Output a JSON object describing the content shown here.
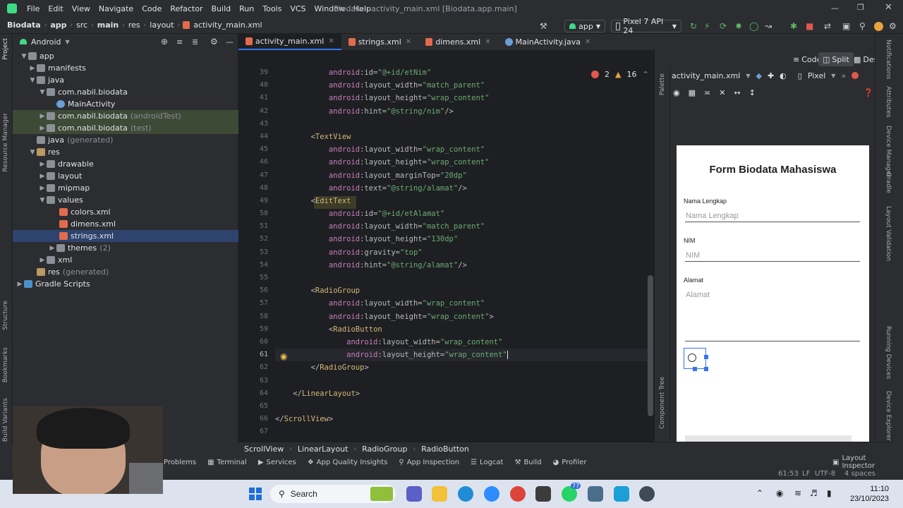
{
  "menu": {
    "items": [
      "File",
      "Edit",
      "View",
      "Navigate",
      "Code",
      "Refactor",
      "Build",
      "Run",
      "Tools",
      "VCS",
      "Window",
      "Help"
    ],
    "title": "Biodata - activity_main.xml [Biodata.app.main]"
  },
  "breadcrumbs": [
    "Biodata",
    "app",
    "src",
    "main",
    "res",
    "layout",
    "activity_main.xml"
  ],
  "toolbar": {
    "run_config": "app",
    "device": "Pixel 7 API 24"
  },
  "project": {
    "view_label": "Android",
    "tree": [
      {
        "label": "app",
        "suffix": ""
      },
      {
        "label": "manifests",
        "suffix": ""
      },
      {
        "label": "java",
        "suffix": ""
      },
      {
        "label": "com.nabil.biodata",
        "suffix": ""
      },
      {
        "label": "MainActivity",
        "suffix": ""
      },
      {
        "label": "com.nabil.biodata",
        "suffix": "(androidTest)"
      },
      {
        "label": "com.nabil.biodata",
        "suffix": "(test)"
      },
      {
        "label": "java",
        "suffix": "(generated)"
      },
      {
        "label": "res",
        "suffix": ""
      },
      {
        "label": "drawable",
        "suffix": ""
      },
      {
        "label": "layout",
        "suffix": ""
      },
      {
        "label": "mipmap",
        "suffix": ""
      },
      {
        "label": "values",
        "suffix": ""
      },
      {
        "label": "colors.xml",
        "suffix": ""
      },
      {
        "label": "dimens.xml",
        "suffix": ""
      },
      {
        "label": "strings.xml",
        "suffix": ""
      },
      {
        "label": "themes",
        "suffix": "(2)"
      },
      {
        "label": "xml",
        "suffix": ""
      },
      {
        "label": "res",
        "suffix": "(generated)"
      },
      {
        "label": "Gradle Scripts",
        "suffix": ""
      }
    ]
  },
  "left_strip": [
    "Project",
    "Resource Manager",
    "Structure",
    "Bookmarks",
    "Build Variants"
  ],
  "tabs": [
    "activity_main.xml",
    "strings.xml",
    "dimens.xml",
    "MainActivity.java"
  ],
  "inspections": {
    "errors": "2",
    "warnings": "16"
  },
  "view_modes": [
    "Code",
    "Split",
    "Design"
  ],
  "editor": {
    "line_numbers": [
      "39",
      "40",
      "41",
      "42",
      "43",
      "44",
      "45",
      "46",
      "47",
      "48",
      "49",
      "50",
      "51",
      "52",
      "53",
      "54",
      "55",
      "56",
      "57",
      "58",
      "59",
      "60",
      "61",
      "62",
      "63",
      "64",
      "65",
      "66",
      "67"
    ],
    "lines": [
      [
        {
          "c": "ns",
          "t": "            android"
        },
        {
          "c": "at",
          "t": ":id="
        },
        {
          "c": "val",
          "t": "\"@+id/etNim\""
        }
      ],
      [
        {
          "c": "ns",
          "t": "            android"
        },
        {
          "c": "at",
          "t": ":layout_width="
        },
        {
          "c": "val",
          "t": "\"match_parent\""
        }
      ],
      [
        {
          "c": "ns",
          "t": "            android"
        },
        {
          "c": "at",
          "t": ":layout_height="
        },
        {
          "c": "val",
          "t": "\"wrap_content\""
        }
      ],
      [
        {
          "c": "ns",
          "t": "            android"
        },
        {
          "c": "at",
          "t": ":hint="
        },
        {
          "c": "val",
          "t": "\"@string/nim\""
        },
        {
          "c": "pun",
          "t": "/>"
        }
      ],
      [
        {
          "c": "pun",
          "t": ""
        }
      ],
      [
        {
          "c": "pun",
          "t": "        <"
        },
        {
          "c": "tag",
          "t": "TextView"
        }
      ],
      [
        {
          "c": "ns",
          "t": "            android"
        },
        {
          "c": "at",
          "t": ":layout_width="
        },
        {
          "c": "val",
          "t": "\"wrap_content\""
        }
      ],
      [
        {
          "c": "ns",
          "t": "            android"
        },
        {
          "c": "at",
          "t": ":layout_height="
        },
        {
          "c": "val",
          "t": "\"wrap_content\""
        }
      ],
      [
        {
          "c": "ns",
          "t": "            android"
        },
        {
          "c": "at",
          "t": ":layout_marginTop="
        },
        {
          "c": "val",
          "t": "\"20dp\""
        }
      ],
      [
        {
          "c": "ns",
          "t": "            android"
        },
        {
          "c": "at",
          "t": ":text="
        },
        {
          "c": "val",
          "t": "\"@string/alamat\""
        },
        {
          "c": "pun",
          "t": "/>"
        }
      ],
      [
        {
          "c": "pun",
          "t": "        <"
        },
        {
          "c": "tag",
          "t": "EditText"
        }
      ],
      [
        {
          "c": "ns",
          "t": "            android"
        },
        {
          "c": "at",
          "t": ":id="
        },
        {
          "c": "val",
          "t": "\"@+id/etAlamat\""
        }
      ],
      [
        {
          "c": "ns",
          "t": "            android"
        },
        {
          "c": "at",
          "t": ":layout_width="
        },
        {
          "c": "val",
          "t": "\"match_parent\""
        }
      ],
      [
        {
          "c": "ns",
          "t": "            android"
        },
        {
          "c": "at",
          "t": ":layout_height="
        },
        {
          "c": "val",
          "t": "\"130dp\""
        }
      ],
      [
        {
          "c": "ns",
          "t": "            android"
        },
        {
          "c": "at",
          "t": ":gravity="
        },
        {
          "c": "val",
          "t": "\"top\""
        }
      ],
      [
        {
          "c": "ns",
          "t": "            android"
        },
        {
          "c": "at",
          "t": ":hint="
        },
        {
          "c": "val",
          "t": "\"@string/alamat\""
        },
        {
          "c": "pun",
          "t": "/>"
        }
      ],
      [
        {
          "c": "pun",
          "t": ""
        }
      ],
      [
        {
          "c": "pun",
          "t": "        <"
        },
        {
          "c": "tag",
          "t": "RadioGroup"
        }
      ],
      [
        {
          "c": "ns",
          "t": "            android"
        },
        {
          "c": "at",
          "t": ":layout_width="
        },
        {
          "c": "val",
          "t": "\"wrap_content\""
        }
      ],
      [
        {
          "c": "ns",
          "t": "            android"
        },
        {
          "c": "at",
          "t": ":layout_height="
        },
        {
          "c": "val",
          "t": "\"wrap_content\""
        },
        {
          "c": "pun",
          "t": ">"
        }
      ],
      [
        {
          "c": "pun",
          "t": "            <"
        },
        {
          "c": "tag",
          "t": "RadioButton"
        }
      ],
      [
        {
          "c": "ns",
          "t": "                android"
        },
        {
          "c": "at",
          "t": ":layout_width="
        },
        {
          "c": "val",
          "t": "\"wrap_content\""
        }
      ],
      [
        {
          "c": "ns",
          "t": "                android"
        },
        {
          "c": "at",
          "t": ":layout_height="
        },
        {
          "c": "val",
          "t": "\"wrap_content\""
        }
      ],
      [
        {
          "c": "pun",
          "t": "        </"
        },
        {
          "c": "tag",
          "t": "RadioGroup"
        },
        {
          "c": "pun",
          "t": ">"
        }
      ],
      [
        {
          "c": "pun",
          "t": ""
        }
      ],
      [
        {
          "c": "pun",
          "t": "    </"
        },
        {
          "c": "tag",
          "t": "LinearLayout"
        },
        {
          "c": "pun",
          "t": ">"
        }
      ],
      [
        {
          "c": "pun",
          "t": ""
        }
      ],
      [
        {
          "c": "pun",
          "t": "</"
        },
        {
          "c": "tag",
          "t": "ScrollView"
        },
        {
          "c": "pun",
          "t": ">"
        }
      ],
      [
        {
          "c": "pun",
          "t": ""
        }
      ]
    ]
  },
  "code_breadcrumb": [
    "ScrollView",
    "LinearLayout",
    "RadioGroup",
    "RadioButton"
  ],
  "design": {
    "file": "activity_main.xml",
    "device": "Pixel",
    "palette_label": "Palette",
    "component_tree_label": "Component Tree",
    "preview": {
      "title": "Form Biodata Mahasiswa",
      "name_label": "Nama Lengkap",
      "name_hint": "Nama Lengkap",
      "nim_label": "NIM",
      "nim_hint": "NIM",
      "alamat_label": "Alamat",
      "alamat_hint": "Alamat"
    }
  },
  "right_strip": [
    "Notifications",
    "Attributes",
    "Device Manager",
    "Gradle",
    "Layout Validation",
    "Running Devices",
    "Device Explorer"
  ],
  "bottom_tools": [
    "Problems",
    "Terminal",
    "Services",
    "App Quality Insights",
    "App Inspection",
    "Logcat",
    "Build",
    "Profiler"
  ],
  "layout_inspector": "Layout Inspector",
  "status": {
    "position": "61:53",
    "eol": "LF",
    "encoding": "UTF-8",
    "indent": "4 spaces"
  },
  "taskbar": {
    "search": "Search",
    "time": "11:10",
    "date": "23/10/2023",
    "badge": "77"
  },
  "colors": {
    "accent": "#3574f0",
    "editor_bg": "#1e1f22",
    "ide_bg": "#2b2d30",
    "taskbar": "#dde3ee"
  }
}
